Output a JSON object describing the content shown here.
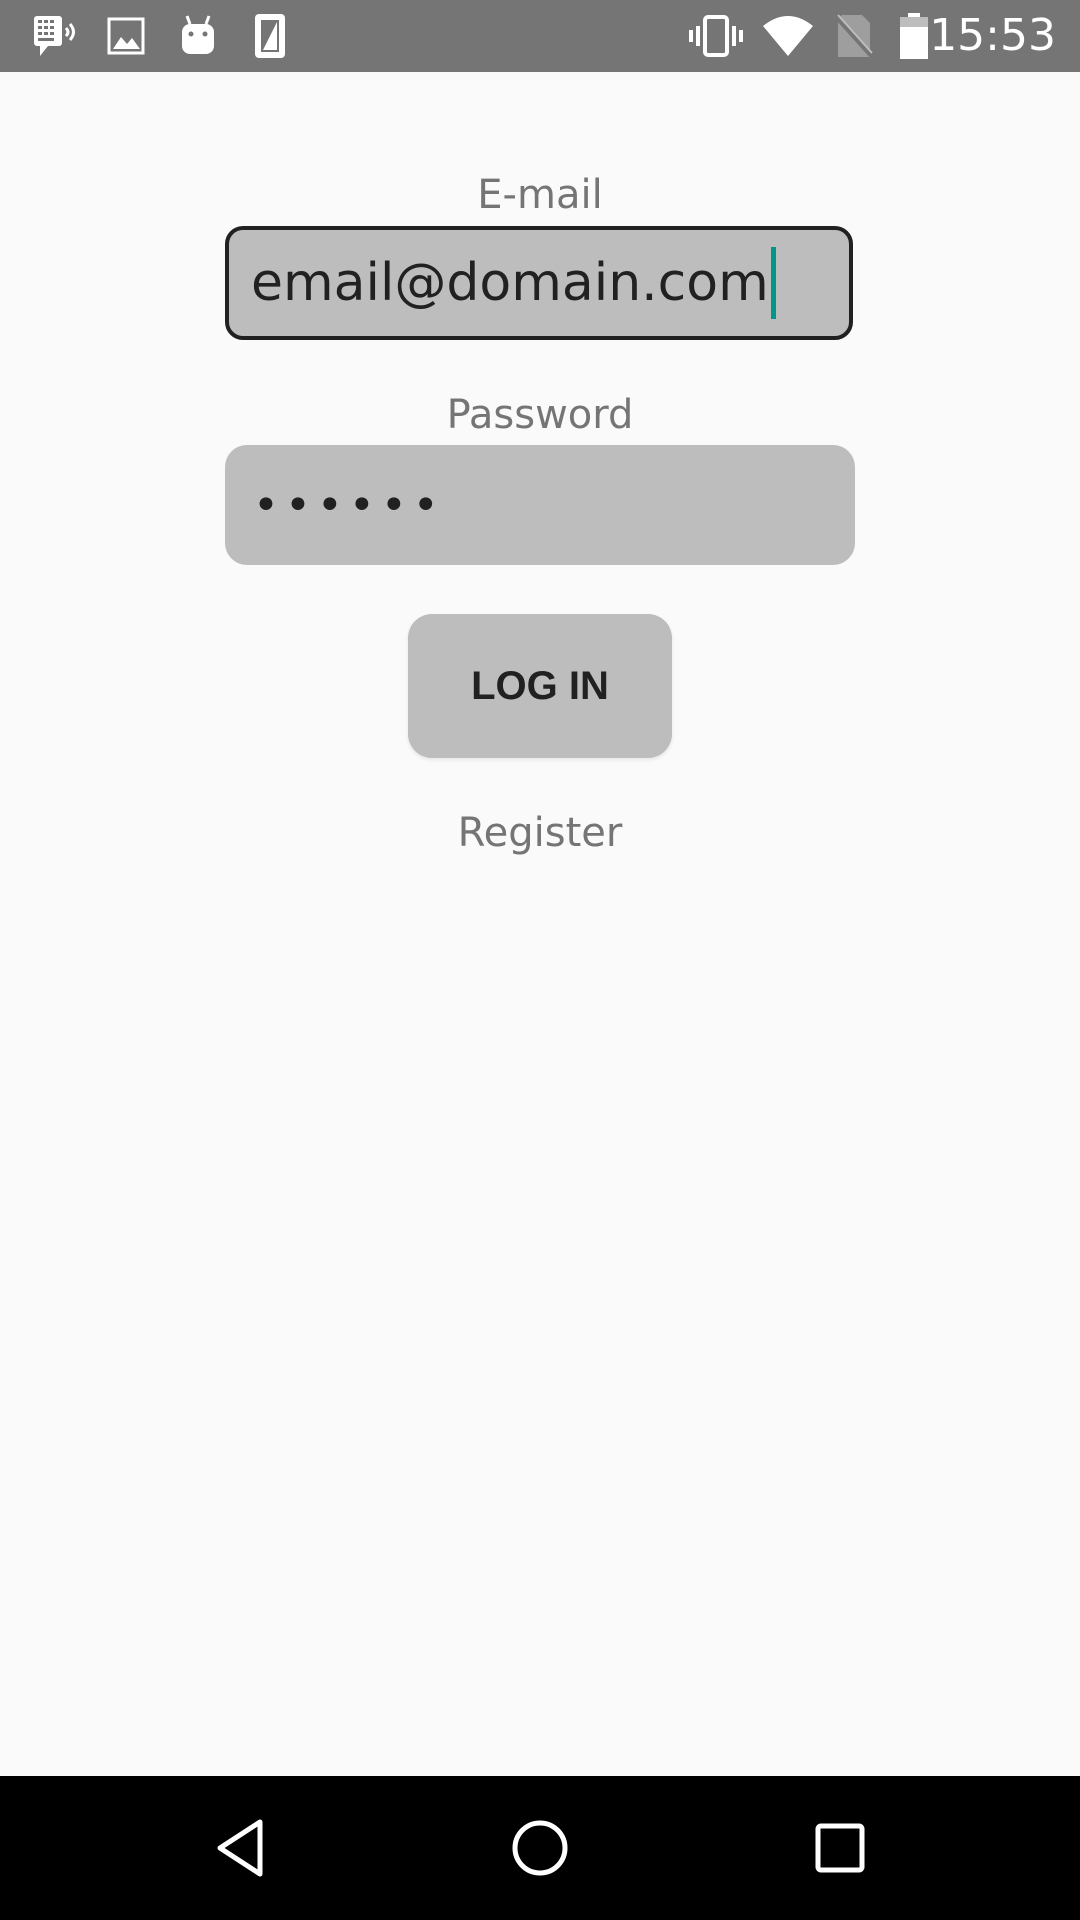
{
  "status_bar": {
    "time": "15:53",
    "left_icons": [
      "keyboard-voice-icon",
      "image-icon",
      "android-icon",
      "sim-card-icon"
    ],
    "right_icons": [
      "vibrate-icon",
      "wifi-icon",
      "no-sim-icon",
      "battery-icon"
    ]
  },
  "form": {
    "email_label": "E-mail",
    "email_value": "email@domain.com",
    "password_label": "Password",
    "password_value": "••••••",
    "login_label": "LOG IN",
    "register_label": "Register"
  },
  "navigation": {
    "back": "back-icon",
    "home": "home-icon",
    "recents": "recents-icon"
  },
  "colors": {
    "status_bar": "#757575",
    "background": "#fafafa",
    "field_fill": "#bdbdbd",
    "field_border_focused": "#212121",
    "caret": "#009688",
    "label_text": "#757575",
    "nav_bar": "#000000"
  }
}
